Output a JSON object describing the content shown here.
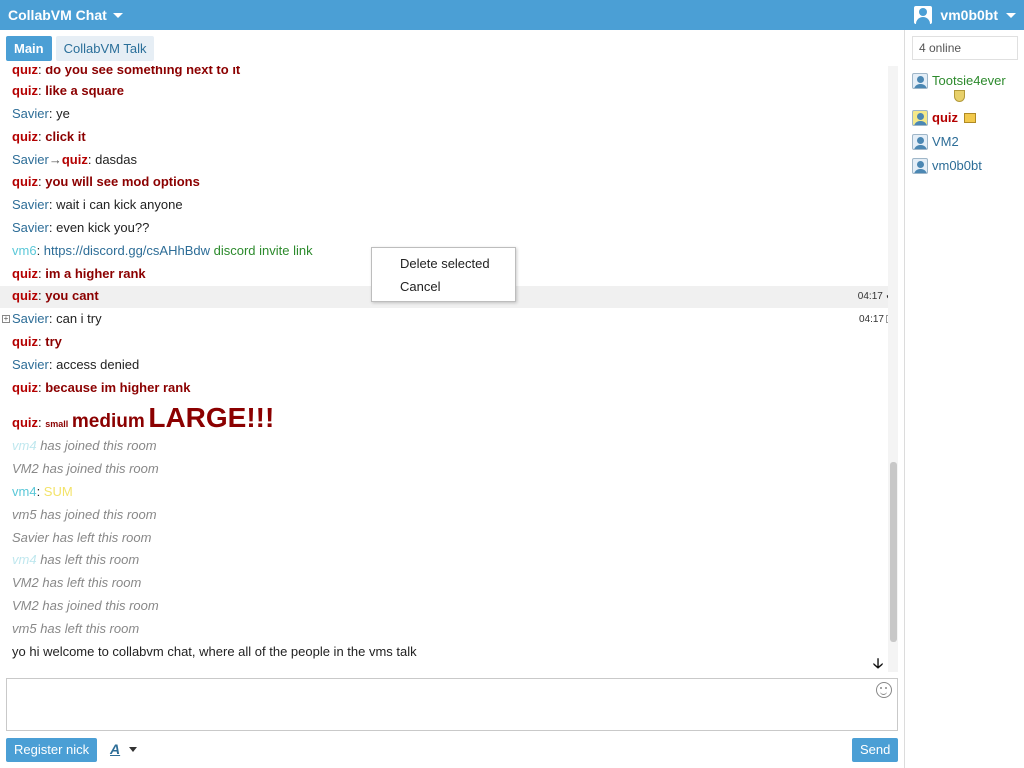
{
  "app": {
    "title": "CollabVM Chat",
    "username": "vm0b0bt"
  },
  "tabs": [
    {
      "label": "Main"
    },
    {
      "label": "CollabVM Talk"
    }
  ],
  "messages": [
    {
      "nick": "quiz",
      "text": "do you see something next to it"
    },
    {
      "nick": "quiz",
      "text": "like a square"
    },
    {
      "nick": "Savier",
      "text": "ye"
    },
    {
      "nick": "quiz",
      "text": "click it"
    },
    {
      "nick": "Savier",
      "arrow": "→",
      "target": "quiz",
      "text": "dasdas"
    },
    {
      "nick": "quiz",
      "text": "you will see mod options"
    },
    {
      "nick": "Savier",
      "text": "wait i can kick anyone"
    },
    {
      "nick": "Savier",
      "text": "even kick you??"
    },
    {
      "nick": "vm6",
      "link": "https://discord.gg/csAHhBdw",
      "text": "discord invite link"
    },
    {
      "nick": "quiz",
      "text": "im a higher rank"
    },
    {
      "nick": "quiz",
      "text": "you cant",
      "time": "04:17"
    },
    {
      "nick": "Savier",
      "text": "can i try",
      "time": "04:17"
    },
    {
      "nick": "quiz",
      "text": "try"
    },
    {
      "nick": "Savier",
      "text": "access denied"
    },
    {
      "nick": "quiz",
      "text": "because im higher rank"
    },
    {
      "nick": "quiz",
      "small": "small",
      "medium": "medium",
      "large": "LARGE!!!"
    },
    {
      "nick": "vm4",
      "text": "has joined this room"
    },
    {
      "nick": "VM2",
      "text": "has joined this room"
    },
    {
      "nick": "vm4",
      "text": "SUM"
    },
    {
      "nick": "vm5",
      "text": "has joined this room"
    },
    {
      "nick": "Savier",
      "text": "has left this room"
    },
    {
      "nick": "vm4",
      "text": "has left this room"
    },
    {
      "nick": "VM2",
      "text": "has left this room"
    },
    {
      "nick": "VM2",
      "text": "has joined this room"
    },
    {
      "nick": "vm5",
      "text": "has left this room"
    },
    {
      "text": "yo hi welcome to collabvm chat, where all of the people in the vms talk"
    }
  ],
  "context_menu": {
    "items": [
      "Delete selected",
      "Cancel"
    ]
  },
  "input": {
    "placeholder": ""
  },
  "buttons": {
    "register": "Register nick",
    "send": "Send",
    "font": "A"
  },
  "sidebar": {
    "online": "4 online",
    "users": [
      {
        "name": "Tootsie4ever",
        "badge": "shield"
      },
      {
        "name": "quiz",
        "badge": "crown"
      },
      {
        "name": "VM2"
      },
      {
        "name": "vm0b0bt"
      }
    ]
  },
  "colors": {
    "accent": "#4b9fd5",
    "quiz": "#b40000",
    "savier": "#2d6d97",
    "vm": "#5bc8d8",
    "green": "#2c8a2c"
  }
}
